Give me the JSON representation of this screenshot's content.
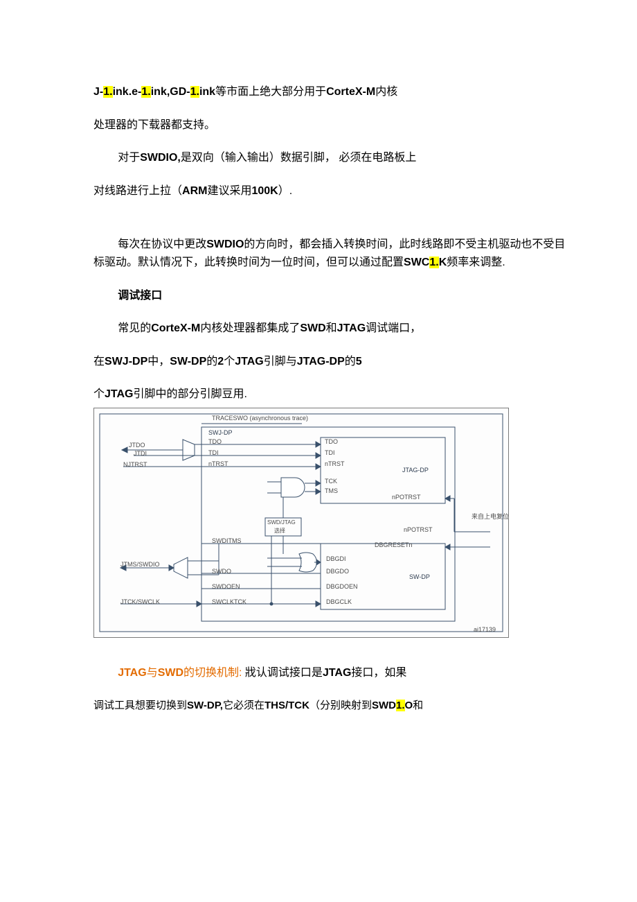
{
  "p1_a": "J-",
  "p1_h1": "1.",
  "p1_b": "ink.e-",
  "p1_h2": "1.",
  "p1_c": "ink,GD-",
  "p1_h3": "1.",
  "p1_d": "ink",
  "p1_e": "等市面上绝大部分用于",
  "p1_f": "CorteX-M",
  "p1_g": "内核",
  "p2": "处理器的下载器都支持。",
  "p3_a": "对于",
  "p3_b": "SWDIO,",
  "p3_c": "是双向（输入输出）数据引脚， 必须在电路板上",
  "p4_a": "对线路进行上拉（",
  "p4_b": "ARM",
  "p4_c": "建议采用",
  "p4_d": "100K",
  "p4_e": "）.",
  "p5_a": "每次在协议中更改",
  "p5_b": "SWDIO",
  "p5_c": "的方向时，都会插入转换时间，此时线路即不受主机驱动也不受目标驱动。默认情况下，此转换时间为一位时间，但可以通过配置",
  "p5_d": "SWC",
  "p5_h": "1.",
  "p5_e": "K",
  "p5_f": "频率来调整.",
  "p6": "调试接口",
  "p7_a": "常见的",
  "p7_b": "CorteX-M",
  "p7_c": "内核处理器都集成了",
  "p7_d": "SWD",
  "p7_e": "和",
  "p7_f": "JTAG",
  "p7_g": "调试端口，",
  "p8_a": "在",
  "p8_b": "SWJ-DP",
  "p8_c": "中，",
  "p8_d": "SW-DP",
  "p8_e": "的",
  "p8_f": "2",
  "p8_g": "个",
  "p8_h": "JTAG",
  "p8_i": "引脚与",
  "p8_j": "JTAG-DP",
  "p8_k": "的",
  "p8_l": "5",
  "p9_a": "个",
  "p9_b": "JTAG",
  "p9_c": "引脚中的部分引脚豆用.",
  "diagram": {
    "top": "TRACESWO  (asynchronous trace)",
    "swj": "SWJ-DP",
    "jtdo": "JTDO",
    "jtdi": "JTDI",
    "njtrst": "NJTRST",
    "jtms": "JTMS/SWDIO",
    "jtck": "JTCK/SWCLK",
    "tdo": "TDO",
    "tdi": "TDI",
    "ntrst": "nTRST",
    "tck": "TCK",
    "tms": "TMS",
    "swdo": "SWDO",
    "swdoen": "SWDOEN",
    "swditms": "SWDITMS",
    "swclktck": "SWCLKTCK",
    "jtagdp": "JTAG-DP",
    "swdp": "SW-DP",
    "to_tdo": "TDO",
    "to_tdi": "TDI",
    "to_ntrst": "nTRST",
    "npotrst1": "nPOTRST",
    "npotrst2": "nPOTRST",
    "dbgreset": "DBGRESETn",
    "dbgdi": "DBGDI",
    "dbgdo": "DBGDO",
    "dbgdoen": "DBGDOEN",
    "dbgclk": "DBGCLK",
    "sel": "SWD/JTAG",
    "sel2": "选择",
    "from": "来自上电复位",
    "figid": "ai17139"
  },
  "p10_a": "JTAG",
  "p10_b": "与",
  "p10_c": "SWD",
  "p10_d": "的切换机制:",
  "p10_e": "戕认调试接口是",
  "p10_f": "JTAG",
  "p10_g": "接口，如果",
  "p11_a": "调试工具想要切换到",
  "p11_b": "SW-DP,",
  "p11_c": "它必须在",
  "p11_d": "THS/TCK",
  "p11_e": "（分别映射到",
  "p11_f": "SWD",
  "p11_h": "1.",
  "p11_g": "O",
  "p11_i": "和"
}
